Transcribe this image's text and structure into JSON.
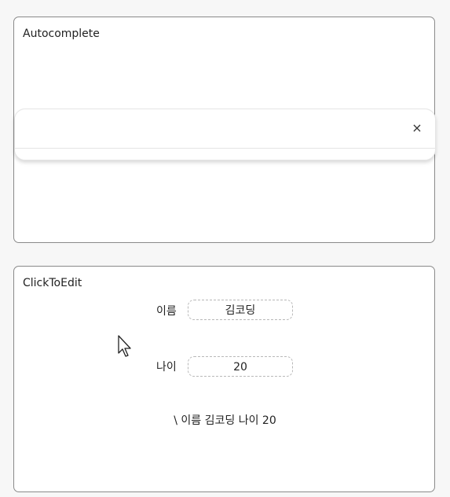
{
  "autocomplete": {
    "title": "Autocomplete",
    "input_value": "",
    "clear_glyph": "×",
    "icons": {
      "clear": "close-icon"
    }
  },
  "click_to_edit": {
    "title": "ClickToEdit",
    "fields": [
      {
        "label": "이름",
        "value": "김코딩"
      },
      {
        "label": "나이",
        "value": "20"
      }
    ],
    "summary": "\\ 이름 김코딩 나이 20"
  }
}
